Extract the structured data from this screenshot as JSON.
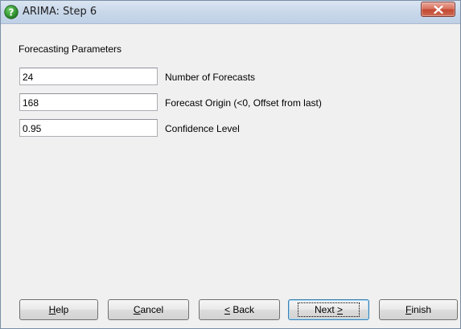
{
  "window": {
    "title": "ARIMA: Step 6",
    "accent_color": "#c34a33",
    "icon": "help-question-icon"
  },
  "section": {
    "heading": "Forecasting Parameters"
  },
  "fields": [
    {
      "value": "24",
      "label": "Number of Forecasts"
    },
    {
      "value": "168",
      "label": "Forecast Origin (<0, Offset from last)"
    },
    {
      "value": "0.95",
      "label": "Confidence Level"
    }
  ],
  "buttons": {
    "help": {
      "mnemonic": "H",
      "rest": "elp"
    },
    "cancel": {
      "mnemonic": "C",
      "rest": "ancel"
    },
    "back": {
      "mnemonic": "<",
      "rest": " Back"
    },
    "next": {
      "label": "Next ",
      "mnemonic": ">"
    },
    "finish": {
      "mnemonic": "F",
      "rest": "inish"
    }
  }
}
